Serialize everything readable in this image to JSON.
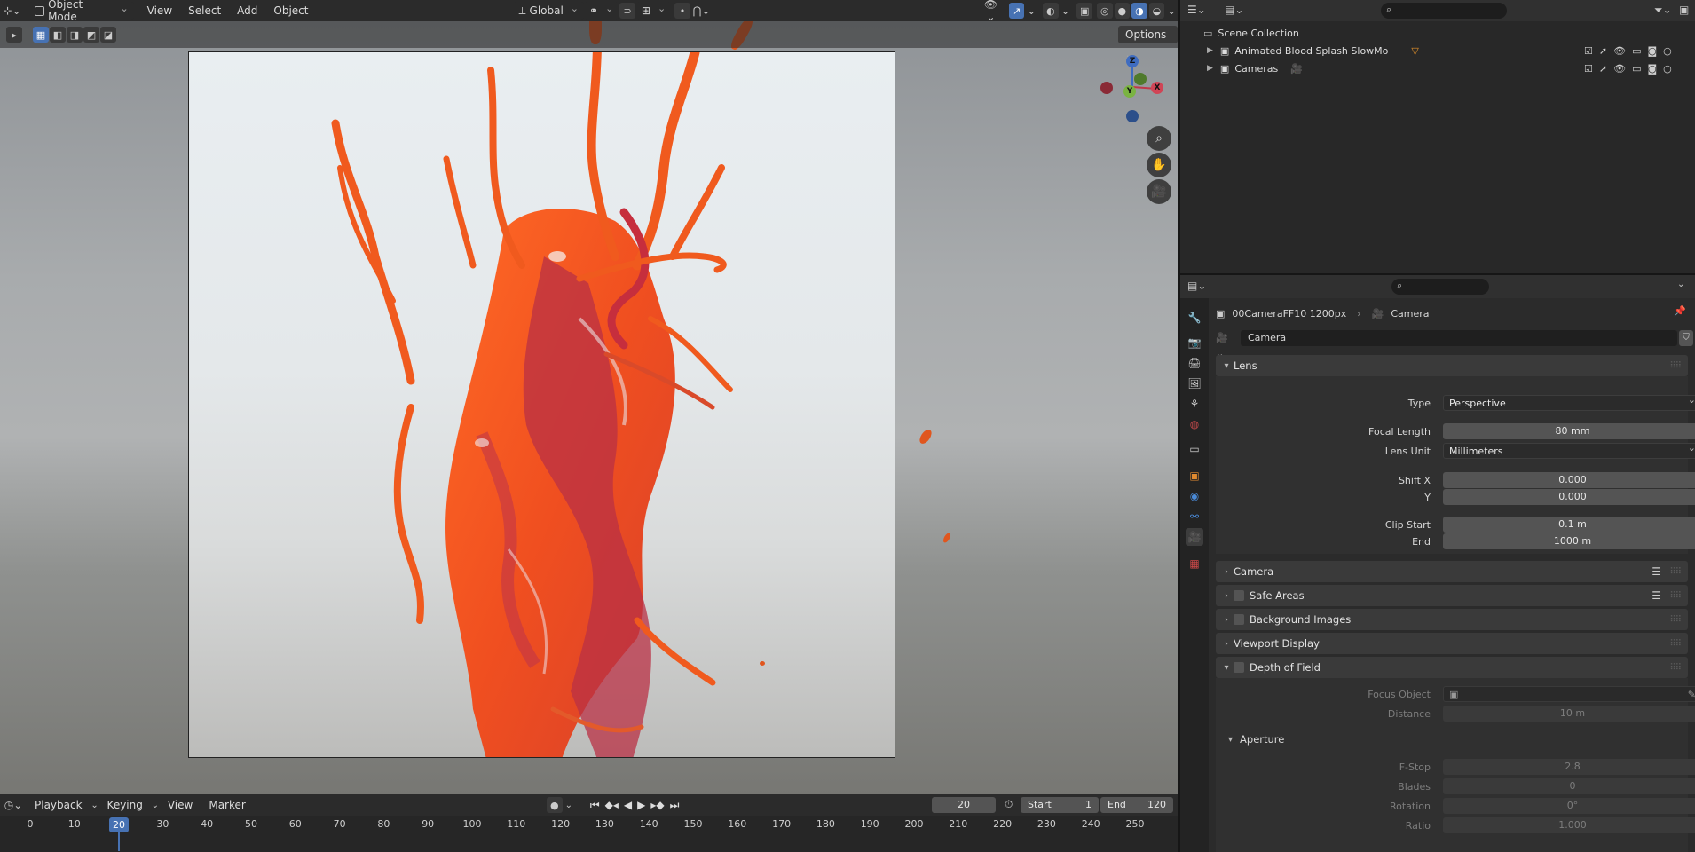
{
  "viewport": {
    "mode_label": "Object Mode",
    "menus": [
      "View",
      "Select",
      "Add",
      "Object"
    ],
    "orientation_label": "Global",
    "options_label": "Options",
    "gizmo": {
      "z": "Z",
      "x": "X",
      "y": "Y"
    }
  },
  "timeline": {
    "menus": [
      "Playback",
      "Keying",
      "View",
      "Marker"
    ],
    "current_frame": "20",
    "start_label": "Start",
    "start_value": "1",
    "end_label": "End",
    "end_value": "120",
    "ticks": [
      "0",
      "10",
      "20",
      "30",
      "40",
      "50",
      "60",
      "70",
      "80",
      "90",
      "100",
      "110",
      "120",
      "130",
      "140",
      "150",
      "160",
      "170",
      "180",
      "190",
      "200",
      "210",
      "220",
      "230",
      "240",
      "250"
    ]
  },
  "outliner": {
    "root": "Scene Collection",
    "items": [
      {
        "label": "Animated Blood Splash SlowMo"
      },
      {
        "label": "Cameras"
      }
    ]
  },
  "properties": {
    "breadcrumb_object": "00CameraFF10 1200px",
    "breadcrumb_data": "Camera",
    "datablock_name": "Camera",
    "lens_panel": "Lens",
    "type_label": "Type",
    "type_value": "Perspective",
    "focal_label": "Focal Length",
    "focal_value": "80 mm",
    "lens_unit_label": "Lens Unit",
    "lens_unit_value": "Millimeters",
    "shift_x_label": "Shift X",
    "shift_x_value": "0.000",
    "shift_y_label": "Y",
    "shift_y_value": "0.000",
    "clip_start_label": "Clip Start",
    "clip_start_value": "0.1 m",
    "clip_end_label": "End",
    "clip_end_value": "1000 m",
    "camera_panel": "Camera",
    "safe_areas_panel": "Safe Areas",
    "bg_images_panel": "Background Images",
    "viewport_display_panel": "Viewport Display",
    "dof_panel": "Depth of Field",
    "focus_object_label": "Focus Object",
    "distance_label": "Distance",
    "distance_value": "10 m",
    "aperture_panel": "Aperture",
    "fstop_label": "F-Stop",
    "fstop_value": "2.8",
    "blades_label": "Blades",
    "blades_value": "0",
    "rotation_label": "Rotation",
    "rotation_value": "0°",
    "ratio_label": "Ratio",
    "ratio_value": "1.000"
  },
  "colors": {
    "accent": "#4772b3",
    "splash_orange": "#f05a1e",
    "splash_red": "#b8283a"
  }
}
